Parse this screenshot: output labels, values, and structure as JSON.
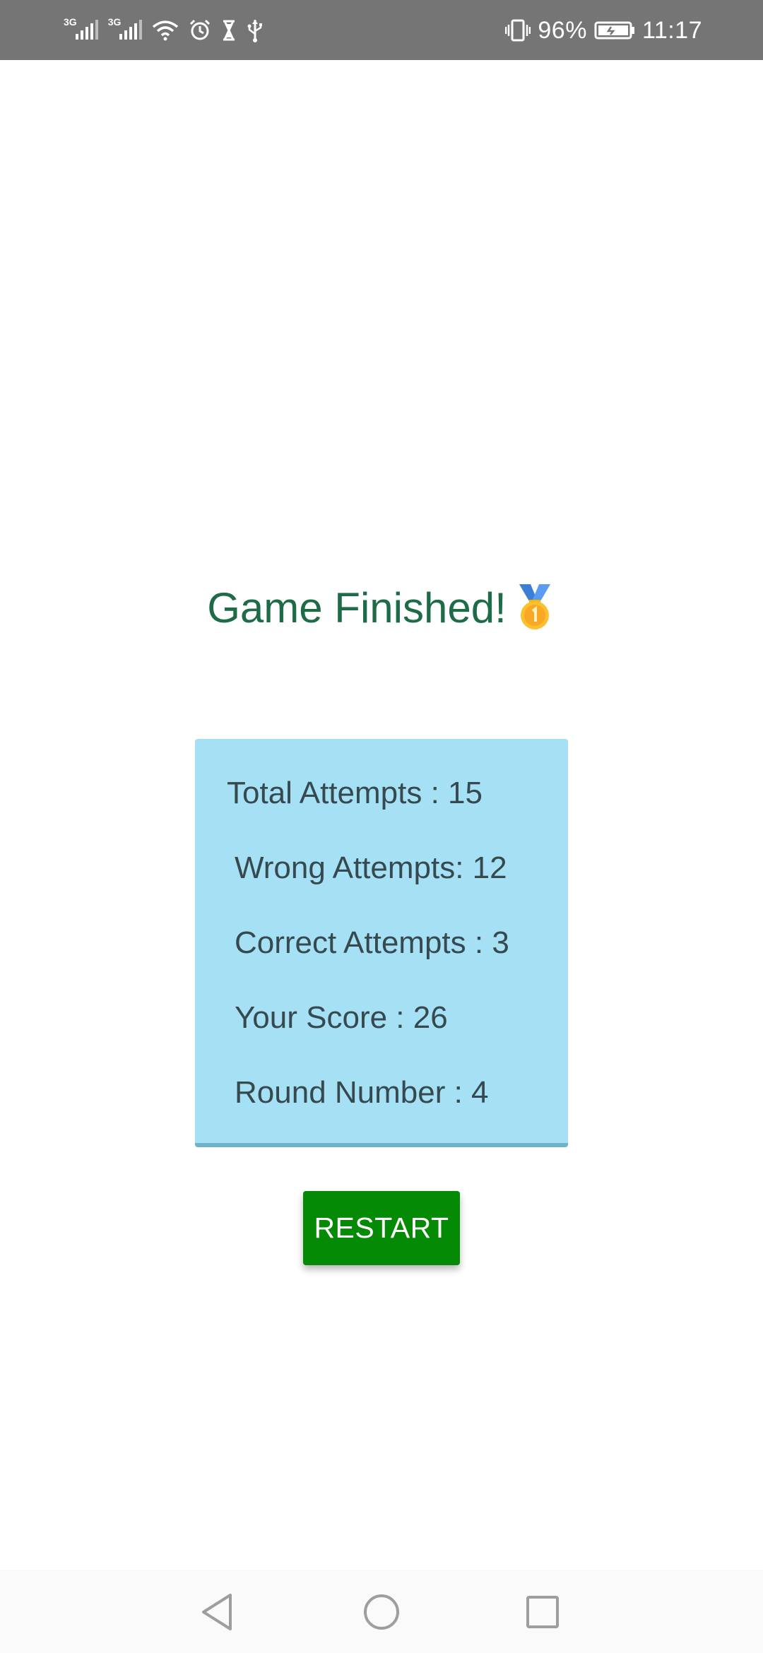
{
  "status_bar": {
    "network_1": "3G",
    "network_2": "3G",
    "icons": [
      "signal-1-icon",
      "signal-2-icon",
      "wifi-icon",
      "alarm-icon",
      "hourglass-icon",
      "usb-icon",
      "vibrate-icon",
      "battery-icon"
    ],
    "battery_percent": "96%",
    "time": "11:17",
    "background_color": "#757575"
  },
  "game": {
    "title": "Game Finished!",
    "title_icon": "medal-icon",
    "title_color": "#1e6b47",
    "stats": {
      "total_attempts": "Total Attempts : 15",
      "wrong_attempts": "Wrong Attempts: 12",
      "correct_attempts": "Correct Attempts : 3",
      "score": "Your Score : 26",
      "round_number": "Round Number : 4"
    },
    "card_color": "#a6e0f4",
    "restart_label": "RESTART",
    "restart_color": "#048a04"
  },
  "nav_bar": {
    "icons": [
      "back-icon",
      "home-icon",
      "recents-icon"
    ]
  }
}
